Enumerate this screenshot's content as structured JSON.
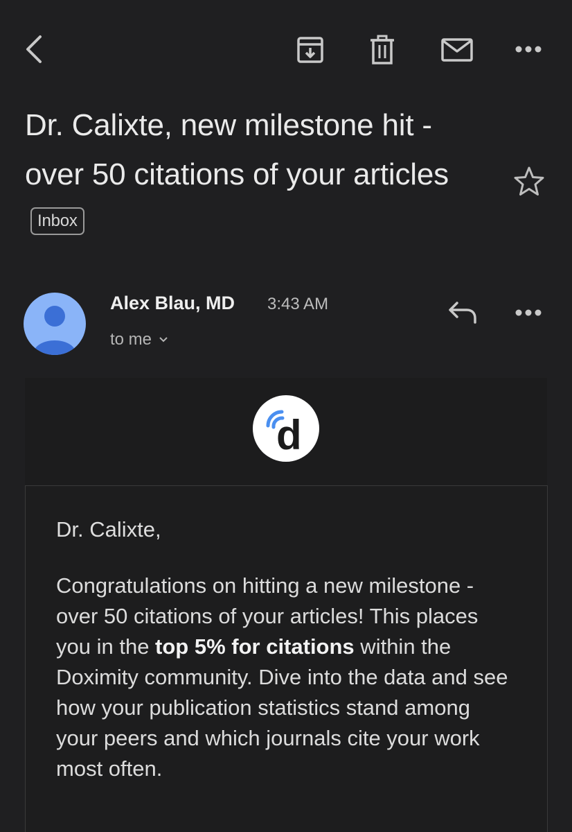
{
  "toolbar": {
    "back_icon": "chevron-left-icon",
    "archive_icon": "archive-icon",
    "delete_icon": "trash-icon",
    "mark_unread_icon": "mail-icon",
    "more_icon": "more-horizontal-icon"
  },
  "email": {
    "subject": "Dr. Calixte, new milestone hit - over 50 citations of your articles",
    "label_badge": "Inbox",
    "starred": false
  },
  "sender": {
    "name": "Alex Blau, MD",
    "time": "3:43 AM",
    "recipient": "to me",
    "avatar_color": "#8ab4f8"
  },
  "body": {
    "logo_letter": "d",
    "greeting": "Dr. Calixte,",
    "paragraph_part1": "Congratulations on hitting a new milestone - over 50 citations of your articles! This places you in the ",
    "paragraph_bold": "top 5% for citations",
    "paragraph_part2": " within the Doximity community. Dive into the data and see how your publication statistics stand among your peers and which journals cite your work most often."
  },
  "colors": {
    "background": "#1f1f21",
    "text": "#e6e6e6",
    "accent_blue": "#4a8ff0"
  }
}
